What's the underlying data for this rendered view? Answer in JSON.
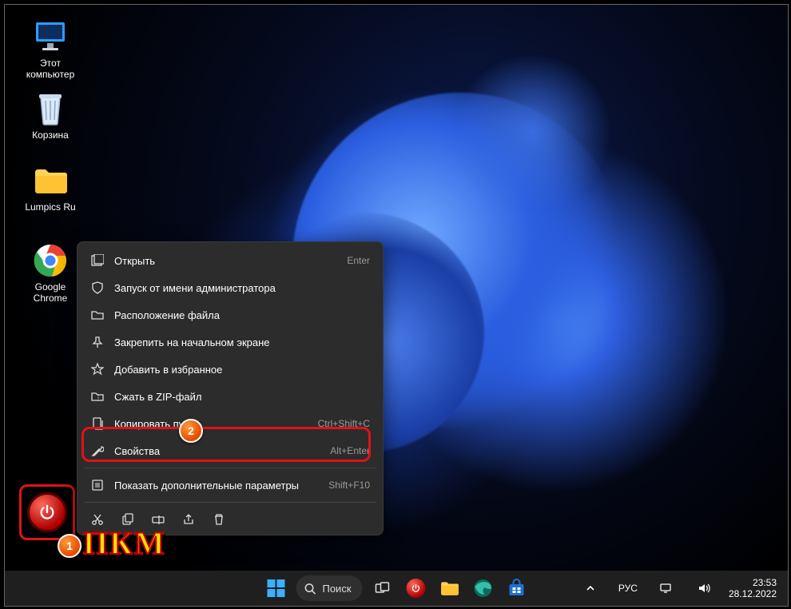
{
  "desktop": {
    "icons": [
      {
        "id": "this-pc",
        "label": "Этот\nкомпьютер"
      },
      {
        "id": "recycle-bin",
        "label": "Корзина"
      },
      {
        "id": "lumpics-folder",
        "label": "Lumpics Ru"
      },
      {
        "id": "chrome",
        "label": "Google\nChrome"
      }
    ]
  },
  "context_menu": {
    "items": [
      {
        "icon": "open-icon",
        "label": "Открыть",
        "shortcut": "Enter"
      },
      {
        "icon": "shield-icon",
        "label": "Запуск от имени администратора",
        "shortcut": ""
      },
      {
        "icon": "folder-icon",
        "label": "Расположение файла",
        "shortcut": ""
      },
      {
        "icon": "pin-icon",
        "label": "Закрепить на начальном экране",
        "shortcut": ""
      },
      {
        "icon": "star-icon",
        "label": "Добавить в избранное",
        "shortcut": ""
      },
      {
        "icon": "zip-icon",
        "label": "Сжать в ZIP-файл",
        "shortcut": ""
      },
      {
        "icon": "copy-path-icon",
        "label": "Копировать путь",
        "shortcut": "Ctrl+Shift+C"
      },
      {
        "icon": "wrench-icon",
        "label": "Свойства",
        "shortcut": "Alt+Enter"
      },
      {
        "icon": "more-icon",
        "label": "Показать дополнительные параметры",
        "shortcut": "Shift+F10"
      }
    ],
    "bottom_icons": [
      "cut-icon",
      "copy-icon",
      "rename-icon",
      "share-icon",
      "delete-icon"
    ]
  },
  "annotations": {
    "badge1": "1",
    "badge2": "2",
    "pkm_label": "ПКМ"
  },
  "taskbar": {
    "search_label": "Поиск",
    "tray": {
      "language": "РУС",
      "time": "23:53",
      "date": "28.12.2022"
    },
    "pinned": [
      "start",
      "search",
      "taskview",
      "app-power",
      "app-explorer",
      "app-edge",
      "app-store"
    ]
  }
}
